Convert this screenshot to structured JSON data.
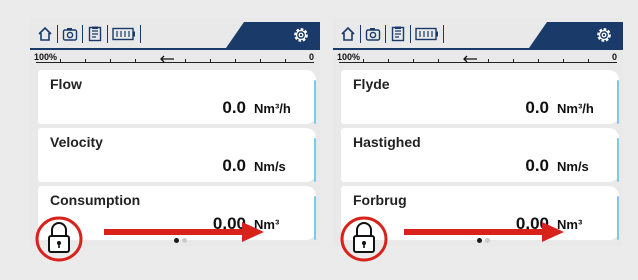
{
  "colors": {
    "navy": "#1a3b6a",
    "accent_line": "#7cc9e8",
    "highlight_red": "#d8231d"
  },
  "screens": [
    {
      "toolbar": {
        "icons": [
          "home-icon",
          "camera-icon",
          "document-icon",
          "battery-icon"
        ],
        "settings_icon": "gear-icon"
      },
      "scale": {
        "max_label": "100%",
        "min_label": "0",
        "direction": "left"
      },
      "cards": [
        {
          "title": "Flow",
          "value": "0.0",
          "unit": "Nm³/h"
        },
        {
          "title": "Velocity",
          "value": "0.0",
          "unit": "Nm/s"
        },
        {
          "title": "Consumption",
          "value": "0.00",
          "unit": "Nm³"
        }
      ],
      "pager": {
        "total": 2,
        "active": 1
      }
    },
    {
      "toolbar": {
        "icons": [
          "home-icon",
          "camera-icon",
          "document-icon",
          "battery-icon"
        ],
        "settings_icon": "gear-icon"
      },
      "scale": {
        "max_label": "100%",
        "min_label": "0",
        "direction": "left"
      },
      "cards": [
        {
          "title": "Flyde",
          "value": "0.0",
          "unit": "Nm³/h"
        },
        {
          "title": "Hastighed",
          "value": "0.0",
          "unit": "Nm/s"
        },
        {
          "title": "Forbrug",
          "value": "0.00",
          "unit": "Nm³"
        }
      ],
      "pager": {
        "total": 2,
        "active": 1
      }
    }
  ],
  "annotations": {
    "lock_icon": "lock-icon",
    "arrow": "arrow-right"
  }
}
